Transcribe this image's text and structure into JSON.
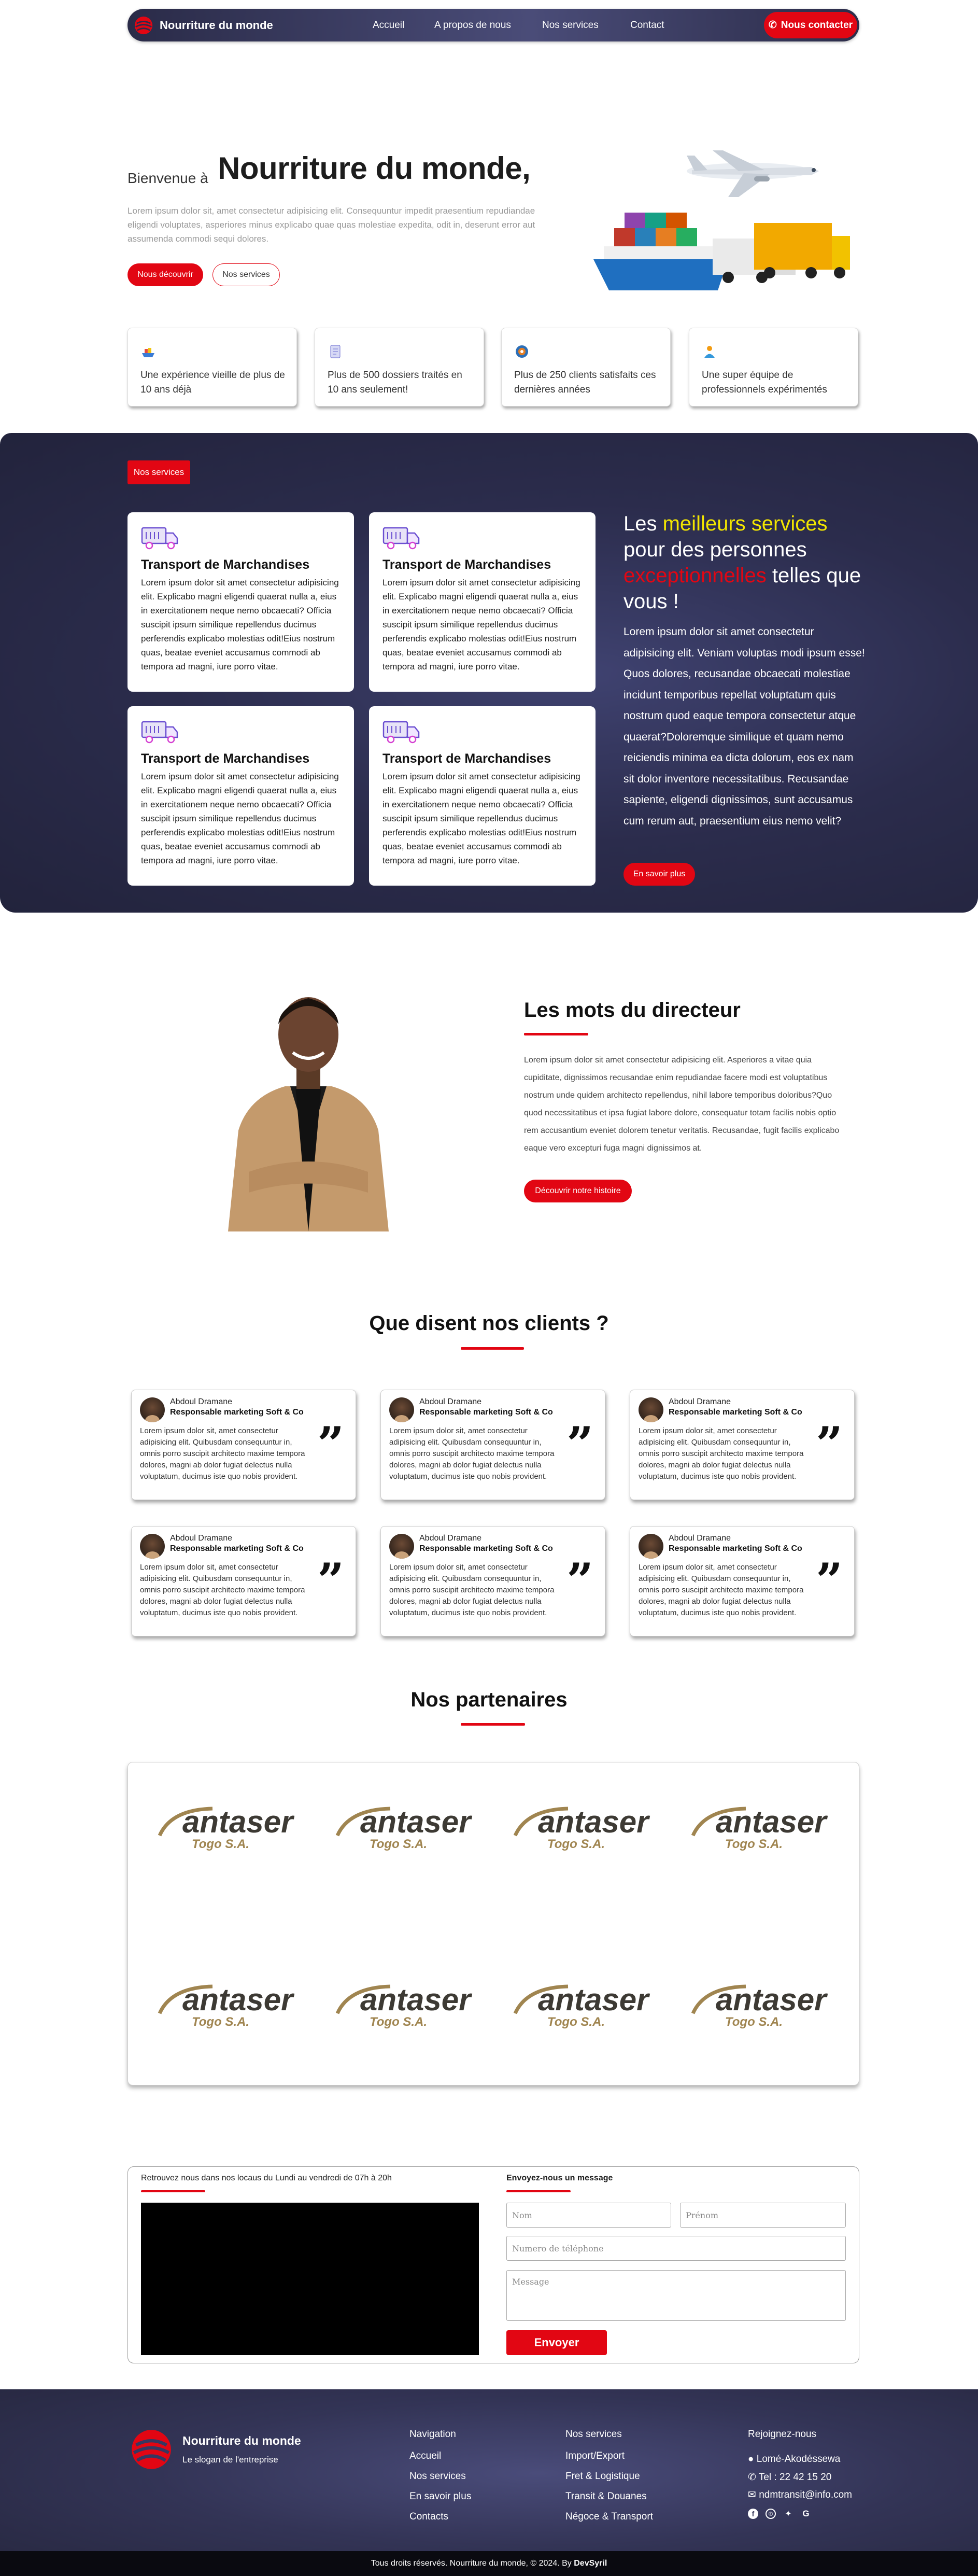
{
  "nav": {
    "brand": "Nourriture du monde",
    "links": [
      "Accueil",
      "A propos de nous",
      "Nos services",
      "Contact"
    ],
    "contact_button": "Nous contacter"
  },
  "hero": {
    "welcome": "Bienvenue  à",
    "title": "Nourriture du monde,",
    "text": "Lorem ipsum dolor sit, amet consectetur adipisicing elit. Consequuntur impedit praesentium repudiandae eligendi voluptates, asperiores minus explicabo quae quas molestiae expedita, odit in, deserunt error aut assumenda commodi sequi dolores.",
    "primary_button": "Nous découvrir",
    "secondary_button": "Nos services"
  },
  "features": [
    {
      "icon": "ship-icon",
      "text": "Une expérience vieille de plus de 10 ans déjà"
    },
    {
      "icon": "document-icon",
      "text": "Plus de 500 dossiers traités en 10 ans seulement!"
    },
    {
      "icon": "satisfied-clients-icon",
      "text": "Plus de 250 clients satisfaits ces dernières années"
    },
    {
      "icon": "team-icon",
      "text": "Une super équipe de professionnels expérimentés"
    }
  ],
  "services": {
    "tag": "Nos services",
    "cards": [
      {
        "title": "Transport de Marchandises",
        "text": "Lorem ipsum dolor sit amet consectetur adipisicing elit. Explicabo magni eligendi quaerat nulla a, eius in exercitationem neque nemo obcaecati? Officia suscipit ipsum similique repellendus ducimus perferendis explicabo molestias odit!Eius nostrum quas, beatae eveniet accusamus commodi ab tempora ad magni, iure porro vitae."
      },
      {
        "title": "Transport de Marchandises",
        "text": "Lorem ipsum dolor sit amet consectetur adipisicing elit. Explicabo magni eligendi quaerat nulla a, eius in exercitationem neque nemo obcaecati? Officia suscipit ipsum similique repellendus ducimus perferendis explicabo molestias odit!Eius nostrum quas, beatae eveniet accusamus commodi ab tempora ad magni, iure porro vitae."
      },
      {
        "title": "Transport de Marchandises",
        "text": "Lorem ipsum dolor sit amet consectetur adipisicing elit. Explicabo magni eligendi quaerat nulla a, eius in exercitationem neque nemo obcaecati? Officia suscipit ipsum similique repellendus ducimus perferendis explicabo molestias odit!Eius nostrum quas, beatae eveniet accusamus commodi ab tempora ad magni, iure porro vitae."
      },
      {
        "title": "Transport de Marchandises",
        "text": "Lorem ipsum dolor sit amet consectetur adipisicing elit. Explicabo magni eligendi quaerat nulla a, eius in exercitationem neque nemo obcaecati? Officia suscipit ipsum similique repellendus ducimus perferendis explicabo molestias odit!Eius nostrum quas, beatae eveniet accusamus commodi ab tempora ad magni, iure porro vitae."
      }
    ],
    "headline_1": "Les ",
    "headline_highlight_1": "meilleurs services",
    "headline_2": " pour des personnes ",
    "headline_highlight_2": "exceptionnelles",
    "headline_3": " telles que vous !",
    "paragraph": "Lorem ipsum dolor sit amet consectetur adipisicing elit. Veniam voluptas modi ipsum esse! Quos dolores, recusandae obcaecati molestiae incidunt temporibus repellat voluptatum quis nostrum quod eaque tempora consectetur atque quaerat?Doloremque similique et quam nemo reiciendis minima ea dicta dolorum, eos ex nam sit dolor inventore necessitatibus. Recusandae sapiente, eligendi dignissimos, sunt accusamus cum rerum aut, praesentium eius nemo velit?",
    "button": "En savoir plus"
  },
  "director": {
    "title": "Les mots du directeur",
    "text": "Lorem ipsum dolor sit amet consectetur adipisicing elit. Asperiores a vitae quia cupiditate, dignissimos recusandae enim repudiandae facere modi est voluptatibus nostrum unde quidem architecto repellendus, nihil labore temporibus doloribus?Quo quod necessitatibus et ipsa fugiat labore dolore, consequatur totam facilis nobis optio rem accusantium eveniet dolorem tenetur veritatis. Recusandae, fugit facilis explicabo eaque vero excepturi fuga magni dignissimos at.",
    "button": "Découvrir notre histoire"
  },
  "testimonials": {
    "title": "Que disent nos clients ?",
    "items": [
      {
        "name": "Abdoul Dramane",
        "role": "Responsable marketing Soft & Co",
        "text": "Lorem ipsum dolor sit, amet consectetur adipisicing elit. Quibusdam consequuntur in, omnis porro suscipit architecto maxime tempora dolores, magni ab dolor fugiat delectus nulla voluptatum, ducimus iste quo nobis provident."
      },
      {
        "name": "Abdoul Dramane",
        "role": "Responsable marketing Soft & Co",
        "text": "Lorem ipsum dolor sit, amet consectetur adipisicing elit. Quibusdam consequuntur in, omnis porro suscipit architecto maxime tempora dolores, magni ab dolor fugiat delectus nulla voluptatum, ducimus iste quo nobis provident."
      },
      {
        "name": "Abdoul Dramane",
        "role": "Responsable marketing Soft & Co",
        "text": "Lorem ipsum dolor sit, amet consectetur adipisicing elit. Quibusdam consequuntur in, omnis porro suscipit architecto maxime tempora dolores, magni ab dolor fugiat delectus nulla voluptatum, ducimus iste quo nobis provident."
      },
      {
        "name": "Abdoul Dramane",
        "role": "Responsable marketing Soft & Co",
        "text": "Lorem ipsum dolor sit, amet consectetur adipisicing elit. Quibusdam consequuntur in, omnis porro suscipit architecto maxime tempora dolores, magni ab dolor fugiat delectus nulla voluptatum, ducimus iste quo nobis provident."
      },
      {
        "name": "Abdoul Dramane",
        "role": "Responsable marketing Soft & Co",
        "text": "Lorem ipsum dolor sit, amet consectetur adipisicing elit. Quibusdam consequuntur in, omnis porro suscipit architecto maxime tempora dolores, magni ab dolor fugiat delectus nulla voluptatum, ducimus iste quo nobis provident."
      },
      {
        "name": "Abdoul Dramane",
        "role": "Responsable marketing Soft & Co",
        "text": "Lorem ipsum dolor sit, amet consectetur adipisicing elit. Quibusdam consequuntur in, omnis porro suscipit architecto maxime tempora dolores, magni ab dolor fugiat delectus nulla voluptatum, ducimus iste quo nobis provident."
      }
    ]
  },
  "partners": {
    "title": "Nos partenaires",
    "logos": [
      {
        "name": "antaser",
        "sub": "Togo S.A."
      },
      {
        "name": "antaser",
        "sub": "Togo S.A."
      },
      {
        "name": "antaser",
        "sub": "Togo S.A."
      },
      {
        "name": "antaser",
        "sub": "Togo S.A."
      },
      {
        "name": "antaser",
        "sub": "Togo S.A."
      },
      {
        "name": "antaser",
        "sub": "Togo S.A."
      },
      {
        "name": "antaser",
        "sub": "Togo S.A."
      },
      {
        "name": "antaser",
        "sub": "Togo S.A."
      }
    ]
  },
  "contact": {
    "hours": "Retrouvez nous dans nos locaus du Lundi au vendredi de 07h à 20h",
    "form_title": "Envoyez-nous un message",
    "name_placeholder": "Nom",
    "firstname_placeholder": "Prénom",
    "phone_placeholder": "Numero de téléphone",
    "message_placeholder": "Message",
    "submit": "Envoyer"
  },
  "footer": {
    "brand": "Nourriture du monde",
    "slogan": "Le slogan de l'entreprise",
    "navigation_title": "Navigation",
    "navigation": [
      "Accueil",
      "Nos services",
      "En savoir plus",
      "Contacts"
    ],
    "services_title": "Nos services",
    "services": [
      "Import/Export",
      "Fret & Logistique",
      "Transit & Douanes",
      "Négoce & Transport"
    ],
    "join_title": "Rejoignez-nous",
    "address": "Lomé-Akodéssewa",
    "phone": "Tel : 22 42 15 20",
    "email": "ndmtransit@info.com",
    "social": [
      "facebook-icon",
      "whatsapp-icon",
      "twitter-icon",
      "google-icon"
    ],
    "copyright": "Tous droits réservés. Nourriture du monde, © 2024. By",
    "credit": "DevSyril"
  },
  "colors": {
    "accent": "#e20613",
    "navy": "#2b2c4c",
    "highlight": "#f3e600",
    "gold": "#a08550"
  }
}
